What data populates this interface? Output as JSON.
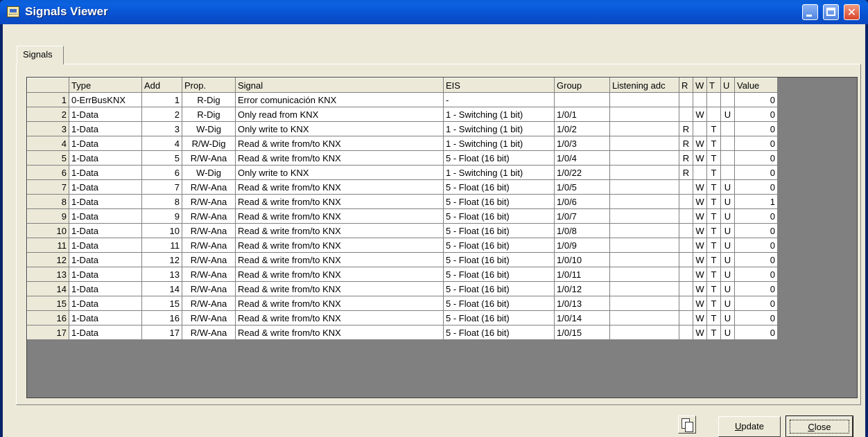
{
  "window": {
    "title": "Signals Viewer"
  },
  "tabs": [
    {
      "label": "Signals"
    }
  ],
  "table": {
    "columns": [
      "",
      "Type",
      "Add",
      "Prop.",
      "Signal",
      "EIS",
      "Group",
      "Listening adc",
      "R",
      "W",
      "T",
      "U",
      "Value"
    ],
    "rows": [
      [
        "1",
        "0-ErrBusKNX",
        "1",
        "R-Dig",
        "Error comunicación KNX",
        "-",
        "",
        "",
        "",
        "",
        "",
        "",
        "0"
      ],
      [
        "2",
        "1-Data",
        "2",
        "R-Dig",
        "Only read from KNX",
        "1 - Switching (1 bit)",
        "1/0/1",
        "",
        "",
        "W",
        "",
        "U",
        "0"
      ],
      [
        "3",
        "1-Data",
        "3",
        "W-Dig",
        "Only write to KNX",
        "1 - Switching (1 bit)",
        "1/0/2",
        "",
        "R",
        "",
        "T",
        "",
        "0"
      ],
      [
        "4",
        "1-Data",
        "4",
        "R/W-Dig",
        "Read & write from/to KNX",
        "1 - Switching (1 bit)",
        "1/0/3",
        "",
        "R",
        "W",
        "T",
        "",
        "0"
      ],
      [
        "5",
        "1-Data",
        "5",
        "R/W-Ana",
        "Read & write from/to KNX",
        "5 - Float (16 bit)",
        "1/0/4",
        "",
        "R",
        "W",
        "T",
        "",
        "0"
      ],
      [
        "6",
        "1-Data",
        "6",
        "W-Dig",
        "Only write to KNX",
        "1 - Switching (1 bit)",
        "1/0/22",
        "",
        "R",
        "",
        "T",
        "",
        "0"
      ],
      [
        "7",
        "1-Data",
        "7",
        "R/W-Ana",
        "Read & write from/to KNX",
        "5 - Float (16 bit)",
        "1/0/5",
        "",
        "",
        "W",
        "T",
        "U",
        "0"
      ],
      [
        "8",
        "1-Data",
        "8",
        "R/W-Ana",
        "Read & write from/to KNX",
        "5 - Float (16 bit)",
        "1/0/6",
        "",
        "",
        "W",
        "T",
        "U",
        "1"
      ],
      [
        "9",
        "1-Data",
        "9",
        "R/W-Ana",
        "Read & write from/to KNX",
        "5 - Float (16 bit)",
        "1/0/7",
        "",
        "",
        "W",
        "T",
        "U",
        "0"
      ],
      [
        "10",
        "1-Data",
        "10",
        "R/W-Ana",
        "Read & write from/to KNX",
        "5 - Float (16 bit)",
        "1/0/8",
        "",
        "",
        "W",
        "T",
        "U",
        "0"
      ],
      [
        "11",
        "1-Data",
        "11",
        "R/W-Ana",
        "Read & write from/to KNX",
        "5 - Float (16 bit)",
        "1/0/9",
        "",
        "",
        "W",
        "T",
        "U",
        "0"
      ],
      [
        "12",
        "1-Data",
        "12",
        "R/W-Ana",
        "Read & write from/to KNX",
        "5 - Float (16 bit)",
        "1/0/10",
        "",
        "",
        "W",
        "T",
        "U",
        "0"
      ],
      [
        "13",
        "1-Data",
        "13",
        "R/W-Ana",
        "Read & write from/to KNX",
        "5 - Float (16 bit)",
        "1/0/11",
        "",
        "",
        "W",
        "T",
        "U",
        "0"
      ],
      [
        "14",
        "1-Data",
        "14",
        "R/W-Ana",
        "Read & write from/to KNX",
        "5 - Float (16 bit)",
        "1/0/12",
        "",
        "",
        "W",
        "T",
        "U",
        "0"
      ],
      [
        "15",
        "1-Data",
        "15",
        "R/W-Ana",
        "Read & write from/to KNX",
        "5 - Float (16 bit)",
        "1/0/13",
        "",
        "",
        "W",
        "T",
        "U",
        "0"
      ],
      [
        "16",
        "1-Data",
        "16",
        "R/W-Ana",
        "Read & write from/to KNX",
        "5 - Float (16 bit)",
        "1/0/14",
        "",
        "",
        "W",
        "T",
        "U",
        "0"
      ],
      [
        "17",
        "1-Data",
        "17",
        "R/W-Ana",
        "Read & write from/to KNX",
        "5 - Float (16 bit)",
        "1/0/15",
        "",
        "",
        "W",
        "T",
        "U",
        "0"
      ]
    ]
  },
  "buttons": {
    "update_pre": "",
    "update_mnemonic": "U",
    "update_post": "pdate",
    "close_pre": "",
    "close_mnemonic": "C",
    "close_post": "lose"
  },
  "icons": {
    "title": "keyboard-screen-icon",
    "copy": "copy-clipboard-icon"
  }
}
